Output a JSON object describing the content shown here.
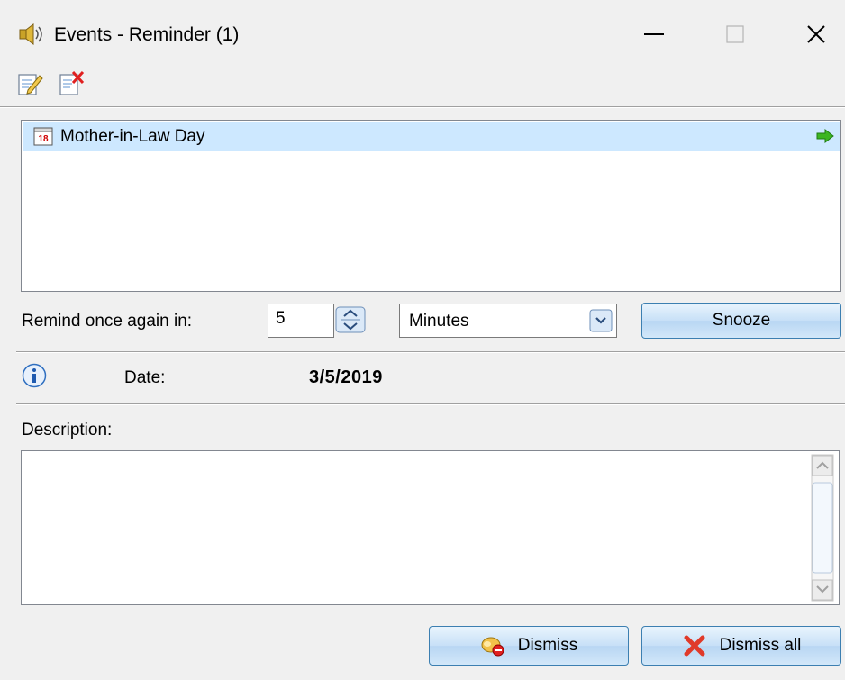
{
  "window": {
    "title": "Events - Reminder (1)",
    "icon": "speaker-icon",
    "controls": {
      "minimize": "minimize-icon",
      "maximize": "maximize-icon",
      "close": "close-icon"
    }
  },
  "toolbar": {
    "items": [
      {
        "name": "edit-event",
        "icon": "edit-note-icon"
      },
      {
        "name": "delete-event",
        "icon": "delete-note-icon"
      }
    ]
  },
  "events": [
    {
      "title": "Mother-in-Law Day",
      "icon": "calendar-icon",
      "calendar_day": "18",
      "selected": true,
      "action_icon": "green-arrow-icon"
    }
  ],
  "snooze": {
    "label": "Remind once again in:",
    "amount": "5",
    "unit": "Minutes",
    "button_label": "Snooze"
  },
  "details": {
    "date_label": "Date:",
    "date_value": "3/5/2019",
    "description_label": "Description:",
    "description_value": ""
  },
  "actions": {
    "dismiss_label": "Dismiss",
    "dismiss_all_label": "Dismiss all"
  },
  "colors": {
    "selection": "#cde8ff",
    "button_border": "#3c7fb1",
    "window_bg": "#f0f0f0"
  }
}
